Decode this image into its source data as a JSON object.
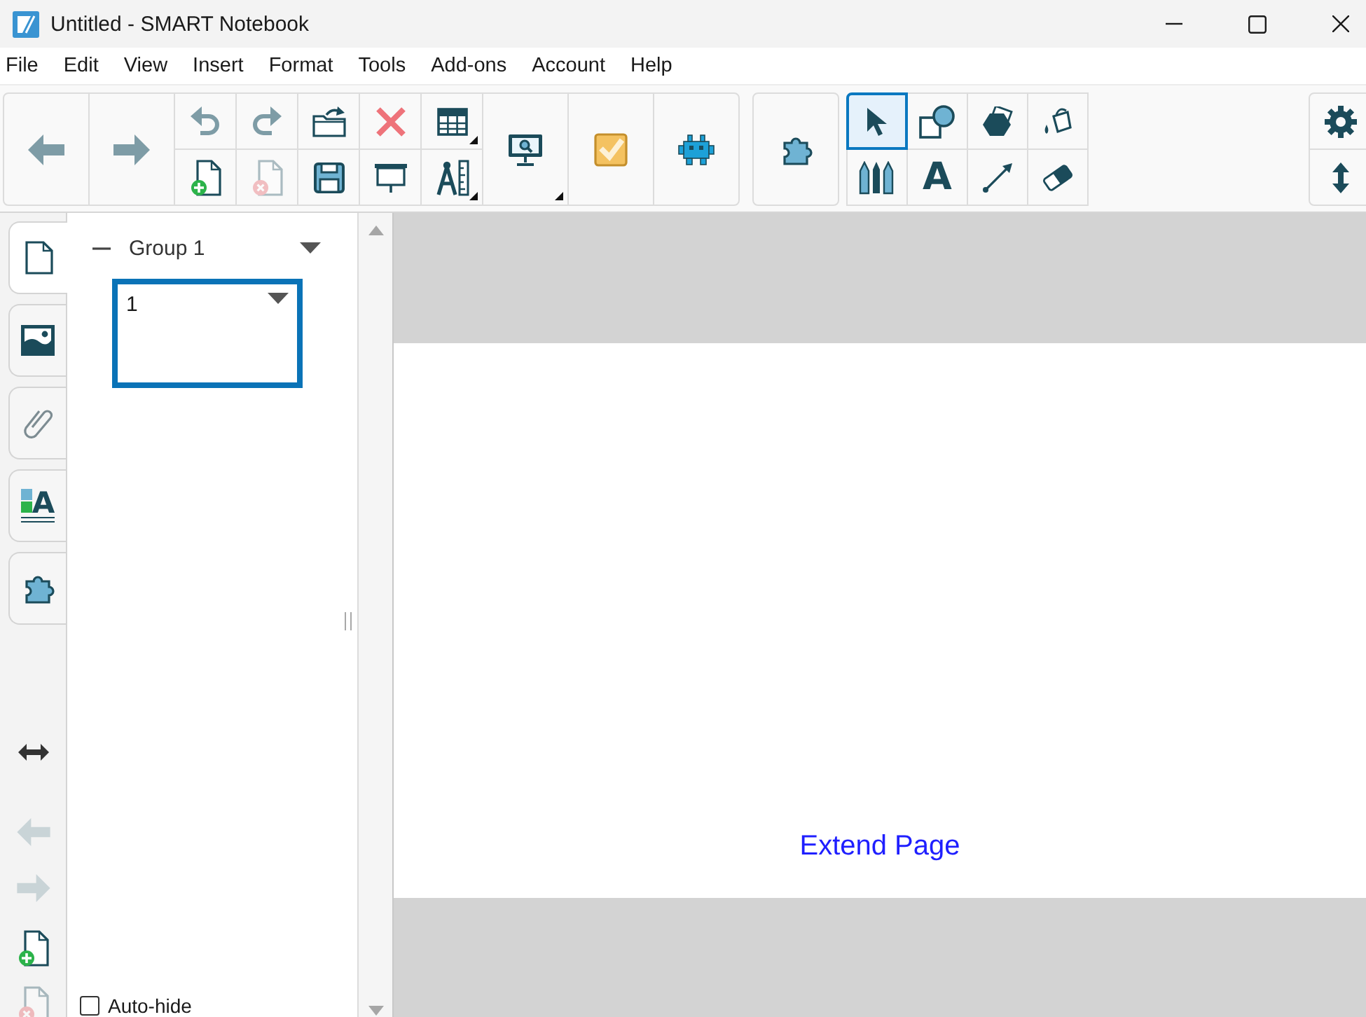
{
  "window": {
    "title": "Untitled - SMART Notebook"
  },
  "menu": [
    "File",
    "Edit",
    "View",
    "Insert",
    "Format",
    "Tools",
    "Add-ons",
    "Account",
    "Help"
  ],
  "toolbar": {
    "navigation": [
      {
        "kind": "back"
      },
      {
        "kind": "forward"
      }
    ],
    "actions": [
      {
        "kind": "undo",
        "disabled": false
      },
      {
        "kind": "redo",
        "disabled": false
      },
      {
        "kind": "open",
        "disabled": false
      },
      {
        "kind": "delete",
        "disabled": false
      },
      {
        "kind": "table",
        "disabled": false
      },
      {
        "kind": "add-page",
        "disabled": false
      },
      {
        "kind": "delete-page",
        "disabled": true
      },
      {
        "kind": "save",
        "disabled": false
      },
      {
        "kind": "show-screen",
        "disabled": false
      },
      {
        "kind": "measure",
        "disabled": false
      }
    ],
    "extras": [
      {
        "kind": "screen-capture"
      },
      {
        "kind": "response"
      },
      {
        "kind": "robot"
      }
    ],
    "addons": [
      {
        "kind": "puzzle"
      }
    ],
    "tools": [
      {
        "kind": "select",
        "selected": true
      },
      {
        "kind": "shapes",
        "selected": false
      },
      {
        "kind": "polygon",
        "selected": false
      },
      {
        "kind": "fill",
        "selected": false
      },
      {
        "kind": "pens",
        "selected": false
      },
      {
        "kind": "text",
        "glyph": "A",
        "selected": false
      },
      {
        "kind": "line",
        "selected": false
      },
      {
        "kind": "eraser",
        "selected": false
      }
    ],
    "settings": [
      {
        "kind": "settings"
      },
      {
        "kind": "resize"
      }
    ]
  },
  "sidebar": {
    "tabs": [
      {
        "kind": "page-sorter",
        "selected": true
      },
      {
        "kind": "gallery",
        "selected": false
      },
      {
        "kind": "attachments",
        "selected": false
      },
      {
        "kind": "properties",
        "glyph": "A",
        "selected": false
      },
      {
        "kind": "puzzle",
        "selected": false
      }
    ],
    "page_tools": [
      {
        "kind": "resize-width",
        "disabled": false
      },
      {
        "kind": "back",
        "disabled": true
      },
      {
        "kind": "forward",
        "disabled": true
      },
      {
        "kind": "add-page",
        "disabled": false
      },
      {
        "kind": "delete-page",
        "disabled": true
      }
    ]
  },
  "page_sorter": {
    "groups": [
      {
        "name": "Group 1",
        "expanded": true,
        "pages": [
          {
            "number": "1",
            "selected": true
          }
        ]
      }
    ],
    "auto_hide": {
      "label": "Auto-hide",
      "checked": false
    }
  },
  "canvas": {
    "extend_link": "Extend Page"
  }
}
